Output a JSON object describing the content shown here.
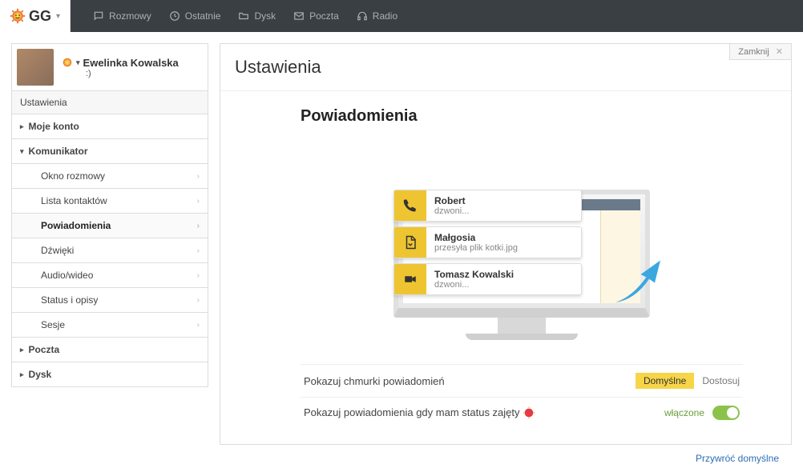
{
  "logo": {
    "text": "GG"
  },
  "topnav": [
    {
      "label": "Rozmowy"
    },
    {
      "label": "Ostatnie"
    },
    {
      "label": "Dysk"
    },
    {
      "label": "Poczta"
    },
    {
      "label": "Radio"
    }
  ],
  "profile": {
    "name": "Ewelinka Kowalska",
    "status": ":)"
  },
  "sidebar": {
    "header": "Ustawienia",
    "sections": {
      "moje_konto": "Moje konto",
      "komunikator": "Komunikator",
      "poczta": "Poczta",
      "dysk": "Dysk"
    },
    "komunikator_items": [
      "Okno rozmowy",
      "Lista kontaktów",
      "Powiadomienia",
      "Dźwięki",
      "Audio/wideo",
      "Status i opisy",
      "Sesje"
    ]
  },
  "content": {
    "title": "Ustawienia",
    "close": "Zamknij",
    "section_title": "Powiadomienia",
    "notifications": [
      {
        "name": "Robert",
        "desc": "dzwoni..."
      },
      {
        "name": "Małgosia",
        "desc": "przesyła plik kotki.jpg"
      },
      {
        "name": "Tomasz Kowalski",
        "desc": "dzwoni..."
      }
    ],
    "settings": {
      "row1": {
        "label": "Pokazuj chmurki powiadomień",
        "default_btn": "Domyślne",
        "customize": "Dostosuj"
      },
      "row2": {
        "label": "Pokazuj powiadomienia gdy mam status zajęty",
        "status": "włączone"
      }
    },
    "footer_link": "Przywróć domyślne"
  }
}
